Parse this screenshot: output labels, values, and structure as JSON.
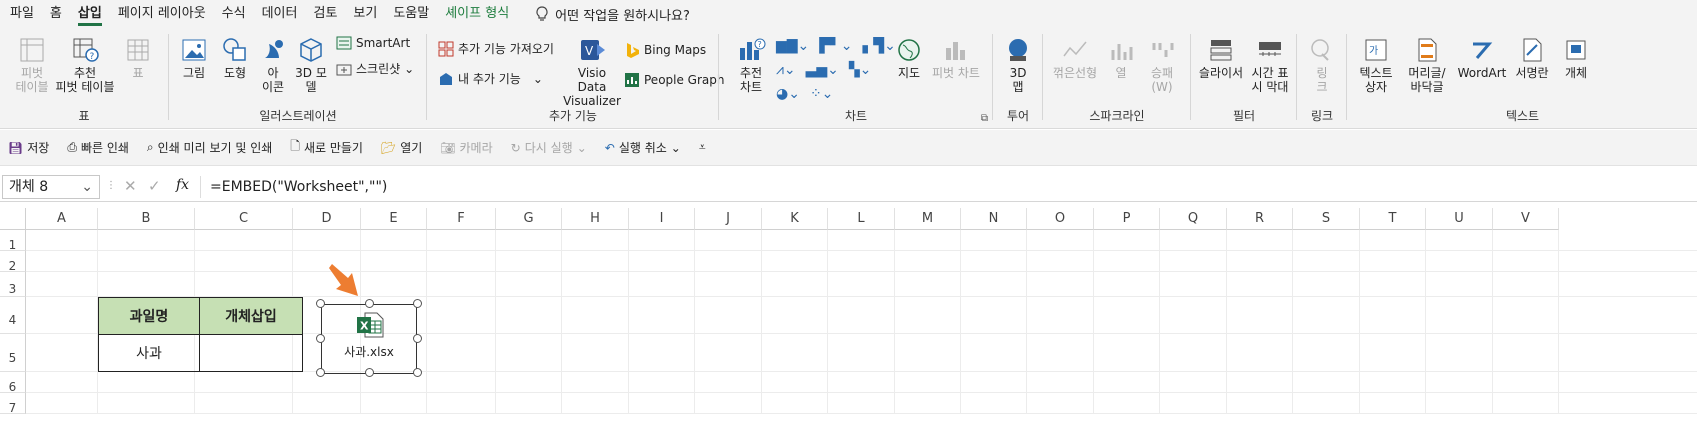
{
  "tabs": [
    {
      "label": "파일",
      "active": false
    },
    {
      "label": "홈",
      "active": false
    },
    {
      "label": "삽입",
      "active": true
    },
    {
      "label": "페이지 레이아웃",
      "active": false
    },
    {
      "label": "수식",
      "active": false
    },
    {
      "label": "데이터",
      "active": false
    },
    {
      "label": "검토",
      "active": false
    },
    {
      "label": "보기",
      "active": false
    },
    {
      "label": "도움말",
      "active": false
    },
    {
      "label": "셰이프 형식",
      "active": false
    }
  ],
  "tell_me": "어떤 작업을 원하시나요?",
  "ribbon": {
    "table": {
      "pivot": "피벗\n테이블",
      "recommended_pivot": "추천\n피벗 테이블",
      "table": "표",
      "group": "표"
    },
    "illustrations": {
      "picture": "그림",
      "shapes": "도형",
      "icons": "아\n이콘",
      "models3d": "3D 모\n델",
      "smartart": "SmartArt",
      "screenshot": "스크린샷",
      "group": "일러스트레이션"
    },
    "addins": {
      "get_addins": "추가 기능 가져오기",
      "my_addins": "내 추가 기능",
      "visio": "Visio Data\nVisualizer",
      "bing": "Bing Maps",
      "people": "People Graph",
      "group": "추가 기능"
    },
    "charts": {
      "recommended": "추전\n차트",
      "maps": "지도",
      "pivot_chart": "피벗 차트",
      "group": "차트"
    },
    "tours": {
      "map3d": "3D\n맵",
      "group": "투어"
    },
    "sparklines": {
      "line": "꺾은선형",
      "column": "열",
      "winloss": "승패\n(W)",
      "group": "스파크라인"
    },
    "filters": {
      "slicer": "슬라이서",
      "timeline": "시간 표\n시 막대",
      "group": "필터"
    },
    "links": {
      "link": "링\n크",
      "group": "링크"
    },
    "text": {
      "textbox": "텍스트\n상자",
      "header_footer": "머리글/\n바닥글",
      "wordart": "WordArt",
      "signature": "서명란",
      "object": "개체",
      "group": "텍스트"
    }
  },
  "qat": {
    "save": "저장",
    "quick_print": "빠른 인쇄",
    "print_preview": "인쇄 미리 보기 및 인쇄",
    "new": "새로 만들기",
    "open": "열기",
    "camera": "카메라",
    "redo": "다시 실행",
    "undo": "실행 취소"
  },
  "formula_bar": {
    "name_box": "개체 8",
    "fx": "fx",
    "formula": "=EMBED(\"Worksheet\",\"\")"
  },
  "columns": [
    "A",
    "B",
    "C",
    "D",
    "E",
    "F",
    "G",
    "H",
    "I",
    "J",
    "K",
    "L",
    "M",
    "N",
    "O",
    "P",
    "Q",
    "R",
    "S",
    "T",
    "U",
    "V"
  ],
  "rows": [
    "1",
    "2",
    "3",
    "4",
    "5",
    "6",
    "7"
  ],
  "table": {
    "header1": "과일명",
    "header2": "개체삽입",
    "cell1": "사과",
    "cell2": ""
  },
  "embedded_object": {
    "label": "사과.xlsx",
    "icon": "excel-file-icon"
  },
  "colors": {
    "accent": "#217346",
    "header_fill": "#c6e0b4",
    "arrow": "#ed7d31"
  }
}
